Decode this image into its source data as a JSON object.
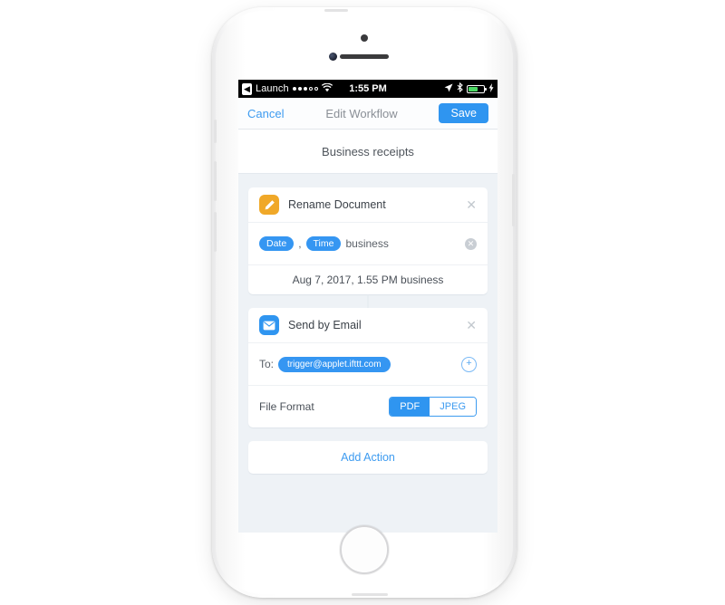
{
  "status_bar": {
    "back_icon": "back-chevron-icon",
    "back_app": "Launch",
    "signal_filled": 3,
    "signal_empty": 2,
    "wifi_icon": "wifi-icon",
    "time": "1:55 PM",
    "location_icon": "location-arrow-icon",
    "bluetooth_icon": "bluetooth-icon",
    "battery_level": 62,
    "battery_color": "#4cd964",
    "charging_icon": "lightning-bolt-icon"
  },
  "nav": {
    "cancel_label": "Cancel",
    "title": "Edit Workflow",
    "save_label": "Save",
    "accent_color": "#2f95f0"
  },
  "workflow": {
    "name": "Business receipts"
  },
  "actions": [
    {
      "icon": "pencil-icon",
      "icon_color": "#f0a828",
      "title": "Rename Document",
      "close_icon": "close-icon",
      "tokens": [
        "Date",
        "Time"
      ],
      "separator": ",",
      "trailing_text": "business",
      "clear_icon": "clear-circle-icon",
      "preview": "Aug 7, 2017, 1.55 PM business"
    },
    {
      "icon": "envelope-icon",
      "icon_color": "#2f95f0",
      "title": "Send by Email",
      "close_icon": "close-icon",
      "to_label": "To:",
      "recipient": "trigger@applet.ifttt.com",
      "add_icon": "plus-circle-icon",
      "format_label": "File Format",
      "format_options": [
        "PDF",
        "JPEG"
      ],
      "format_selected": "PDF"
    }
  ],
  "footer": {
    "add_action_label": "Add Action"
  }
}
